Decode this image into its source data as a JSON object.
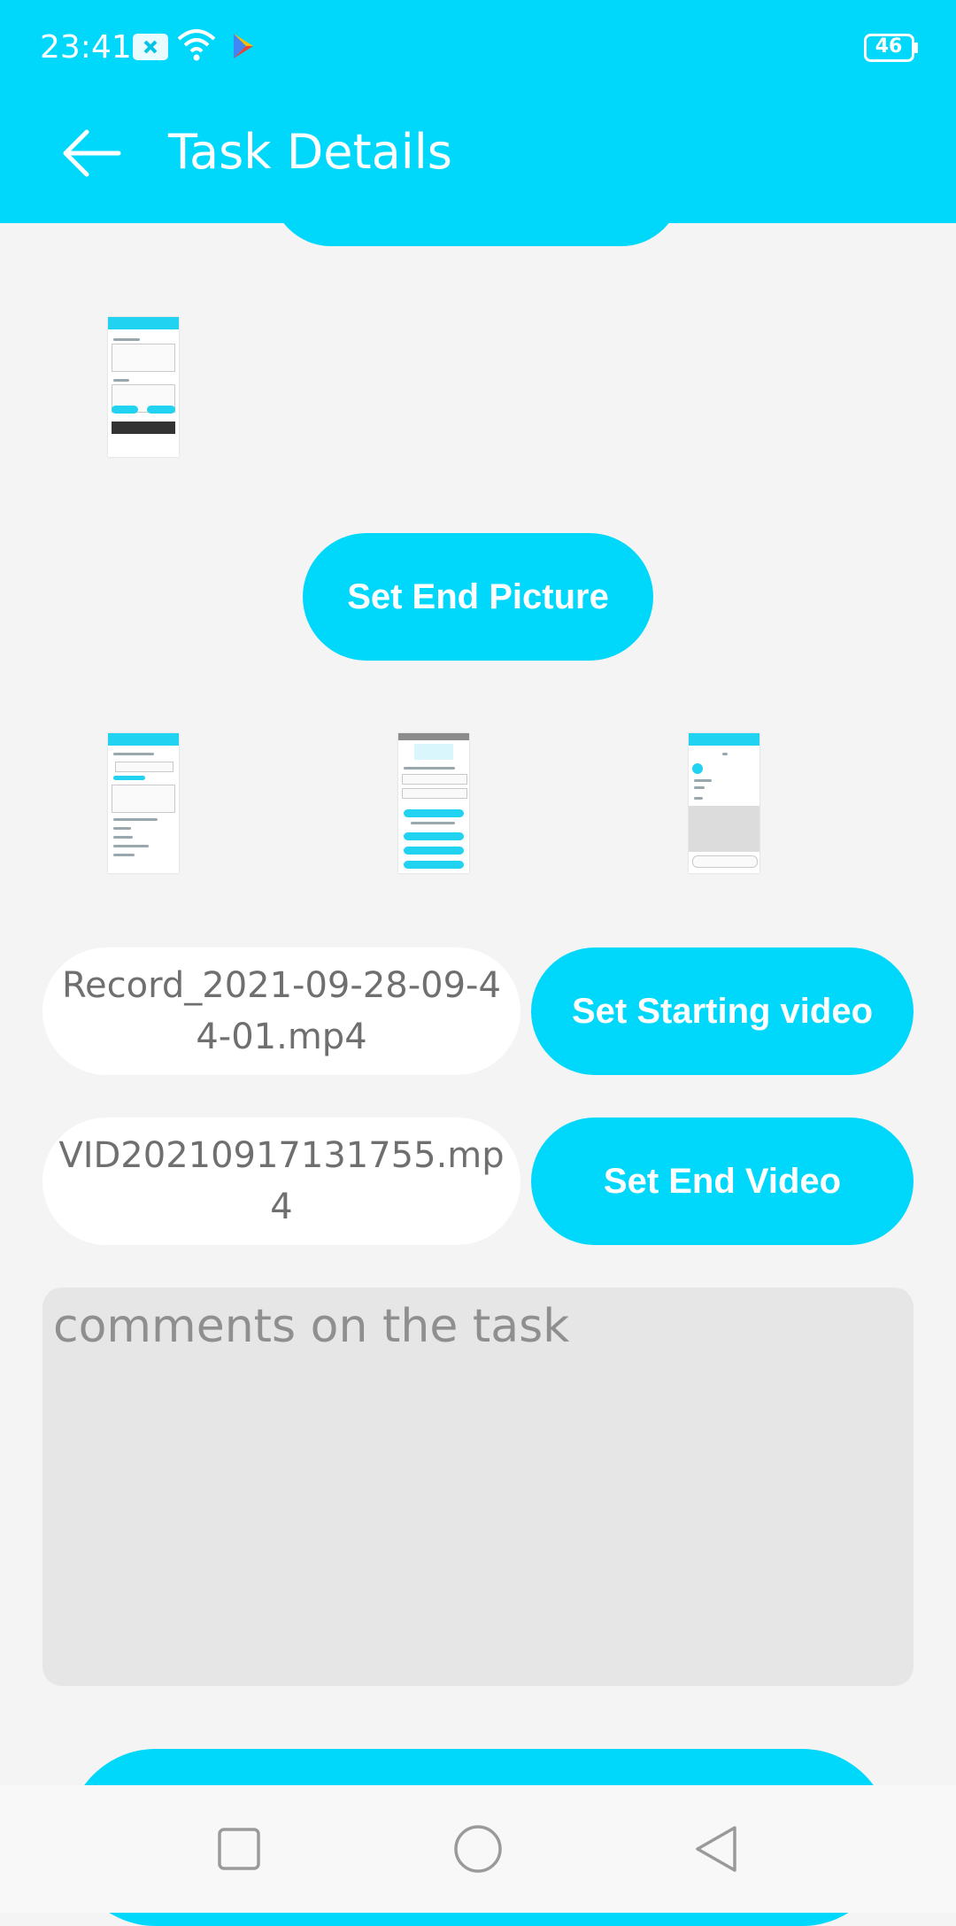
{
  "status_bar": {
    "time": "23:41",
    "battery": "46",
    "icons": [
      "notification-x-icon",
      "wifi-icon",
      "play-store-icon",
      "battery-icon"
    ]
  },
  "app_bar": {
    "title": "Task Details",
    "back_icon": "arrow-left-icon"
  },
  "buttons": {
    "set_end_picture": "Set End Picture",
    "set_starting_video": "Set Starting video",
    "set_end_video": "Set End Video"
  },
  "videos": {
    "starting_file": "Record_2021-09-28-09-44-01.mp4",
    "end_file": "VID20210917131755.mp4"
  },
  "comments": {
    "placeholder": "comments on the task",
    "value": ""
  },
  "navigation": {
    "icons": [
      "recent-apps-icon",
      "home-icon",
      "back-triangle-icon"
    ]
  },
  "colors": {
    "accent": "#00d8fb",
    "background": "#f4f4f4",
    "field": "#ffffff",
    "comments_bg": "#e6e6e6"
  }
}
